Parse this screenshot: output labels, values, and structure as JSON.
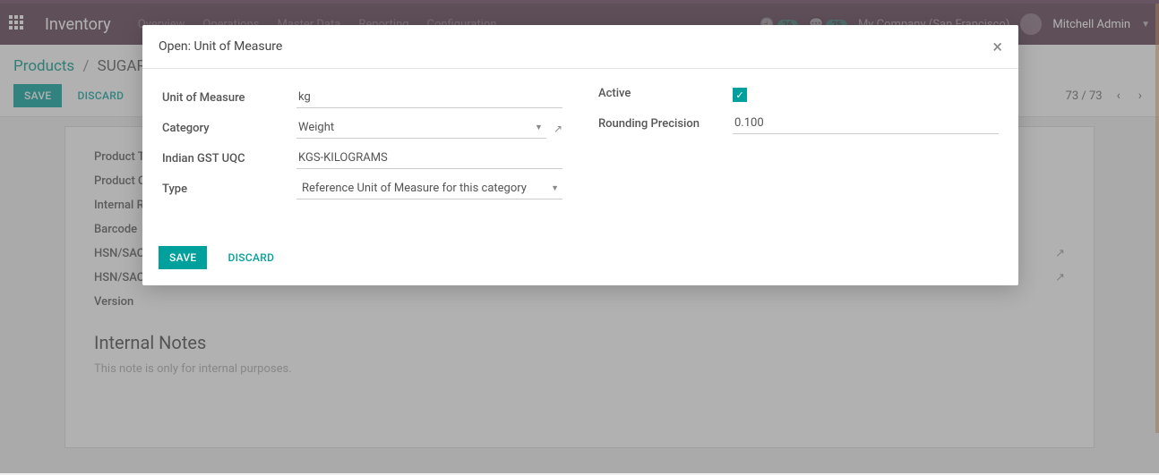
{
  "topbar": {
    "brand": "Inventory",
    "menu": [
      "Overview",
      "Operations",
      "Master Data",
      "Reporting",
      "Configuration"
    ],
    "badge1": "26",
    "badge2": "25",
    "company": "My Company (San Francisco)",
    "user": "Mitchell Admin"
  },
  "breadcrumb": {
    "root": "Products",
    "current": "SUGAR"
  },
  "actions": {
    "save": "SAVE",
    "discard": "DISCARD"
  },
  "pager": {
    "text": "73 / 73"
  },
  "form": {
    "labels": {
      "product_type": "Product Type",
      "product_cat": "Product Category",
      "internal_ref": "Internal Reference",
      "barcode": "Barcode",
      "hsn1": "HSN/SAC Code",
      "hsn2": "HSN/SAC Desc",
      "version": "Version"
    },
    "internal_notes_heading": "Internal Notes",
    "internal_notes_placeholder": "This note is only for internal purposes."
  },
  "modal": {
    "title": "Open: Unit of Measure",
    "labels": {
      "uom": "Unit of Measure",
      "category": "Category",
      "uqc": "Indian GST UQC",
      "type": "Type",
      "active": "Active",
      "rounding": "Rounding Precision"
    },
    "values": {
      "uom": "kg",
      "category": "Weight",
      "uqc": "KGS-KILOGRAMS",
      "type": "Reference Unit of Measure for this category",
      "rounding": "0.100"
    },
    "active_check": "✓",
    "save": "SAVE",
    "discard": "DISCARD"
  }
}
